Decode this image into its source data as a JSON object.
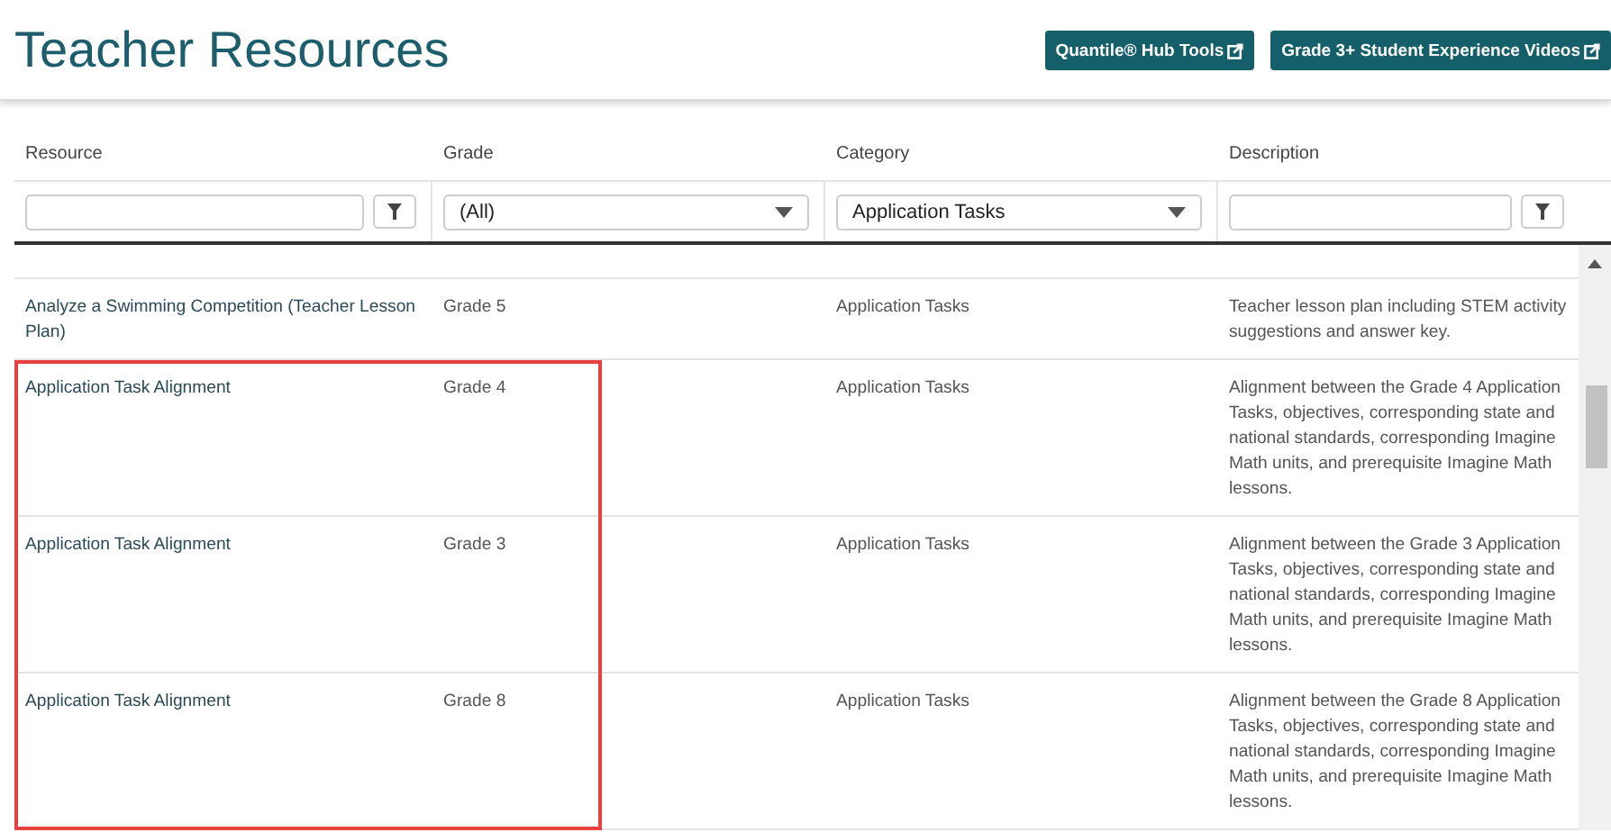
{
  "page": {
    "title": "Teacher Resources"
  },
  "header_buttons": [
    {
      "label": "Quantile® Hub Tools"
    },
    {
      "label": "Grade 3+ Student Experience Videos"
    }
  ],
  "table": {
    "columns": [
      "Resource",
      "Grade",
      "Category",
      "Description"
    ],
    "filters": [
      {
        "kind": "text"
      },
      {
        "kind": "select",
        "value": "(All)"
      },
      {
        "kind": "select",
        "value": "Application Tasks"
      },
      {
        "kind": "text"
      }
    ],
    "rows": [
      {
        "resource": "Analyze a Swimming Competition (Teacher Lesson Plan)",
        "grade": "Grade 5",
        "category": "Application Tasks",
        "description": "Teacher lesson plan including STEM activity suggestions and answer key.",
        "highlighted": false
      },
      {
        "resource": "Application Task Alignment",
        "grade": "Grade 4",
        "category": "Application Tasks",
        "description": "Alignment between the Grade 4 Application Tasks, objectives, corresponding state and national standards, corresponding Imagine Math units, and prerequisite Imagine Math lessons.",
        "highlighted": true
      },
      {
        "resource": "Application Task Alignment",
        "grade": "Grade 3",
        "category": "Application Tasks",
        "description": "Alignment between the Grade 3 Application Tasks, objectives, corresponding state and national standards, corresponding Imagine Math units, and prerequisite Imagine Math lessons.",
        "highlighted": true
      },
      {
        "resource": "Application Task Alignment",
        "grade": "Grade 8",
        "category": "Application Tasks",
        "description": "Alignment between the Grade 8 Application Tasks, objectives, corresponding state and national standards, corresponding Imagine Math units, and prerequisite Imagine Math lessons.",
        "highlighted": true
      }
    ]
  }
}
